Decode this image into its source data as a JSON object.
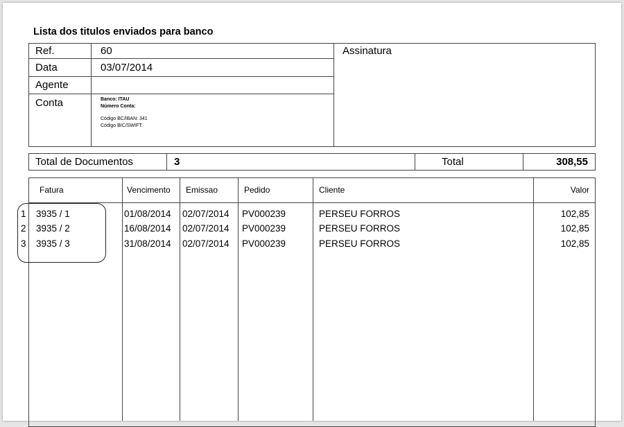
{
  "header": {
    "title": "Lista dos titulos enviados para banco"
  },
  "info": {
    "ref_label": "Ref.",
    "ref_value": "60",
    "data_label": "Data",
    "data_value": "03/07/2014",
    "agente_label": "Agente",
    "agente_value": "",
    "conta_label": "Conta",
    "conta_lines": [
      "Banco: ITAU",
      "Número Conta:",
      "Código BC/IBAN: 341",
      "Código BIC/SWIFT:"
    ],
    "assinatura_label": "Assinatura"
  },
  "totals": {
    "docs_label": "Total de Documentos",
    "docs_value": "3",
    "total_label": "Total",
    "total_value": "308,55"
  },
  "table": {
    "columns": [
      "Fatura",
      "Vencimento",
      "Emissao",
      "Pedido",
      "Cliente",
      "Valor"
    ],
    "rows": [
      {
        "num": "1",
        "fatura": "3935 / 1",
        "vencimento": "01/08/2014",
        "emissao": "02/07/2014",
        "pedido": "PV000239",
        "cliente": "PERSEU FORROS",
        "valor": "102,85"
      },
      {
        "num": "2",
        "fatura": "3935 / 2",
        "vencimento": "16/08/2014",
        "emissao": "02/07/2014",
        "pedido": "PV000239",
        "cliente": "PERSEU FORROS",
        "valor": "102,85"
      },
      {
        "num": "3",
        "fatura": "3935 / 3",
        "vencimento": "31/08/2014",
        "emissao": "02/07/2014",
        "pedido": "PV000239",
        "cliente": "PERSEU FORROS",
        "valor": "102,85"
      }
    ]
  }
}
